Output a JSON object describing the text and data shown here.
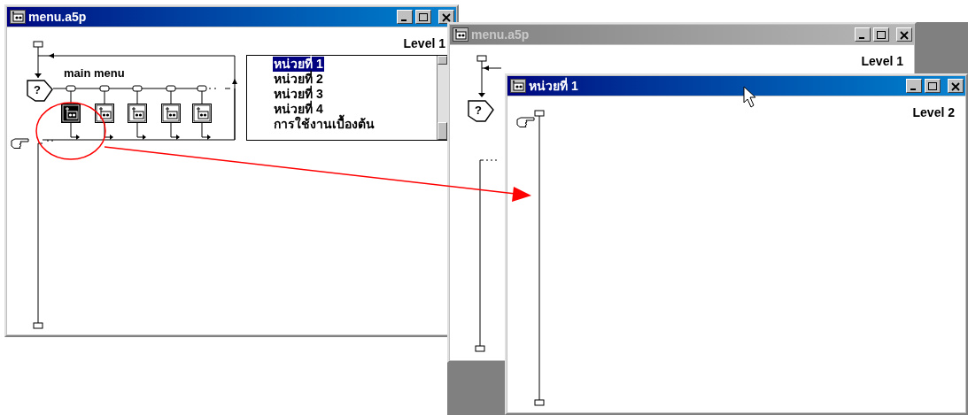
{
  "windows": [
    {
      "title": "menu.a5p",
      "active": true,
      "level_label": "Level 1",
      "decision": "?",
      "interaction_title": "main menu",
      "map_icons": [
        {
          "selected": true
        },
        {
          "selected": false
        },
        {
          "selected": false
        },
        {
          "selected": false
        },
        {
          "selected": false
        }
      ],
      "menu_items": [
        {
          "label": "หน่วยที่ 1",
          "selected": true
        },
        {
          "label": "หน่วยที่ 2",
          "selected": false
        },
        {
          "label": "หน่วยที่ 3",
          "selected": false
        },
        {
          "label": "หน่วยที่ 4",
          "selected": false
        },
        {
          "label": "การใช้งานเบื้องต้น",
          "selected": false
        }
      ]
    },
    {
      "title": "menu.a5p",
      "active": false,
      "level_label": "Level 1",
      "decision": "?"
    },
    {
      "title": "หน่วยที่ 1",
      "active": true,
      "level_label": "Level 2"
    }
  ]
}
